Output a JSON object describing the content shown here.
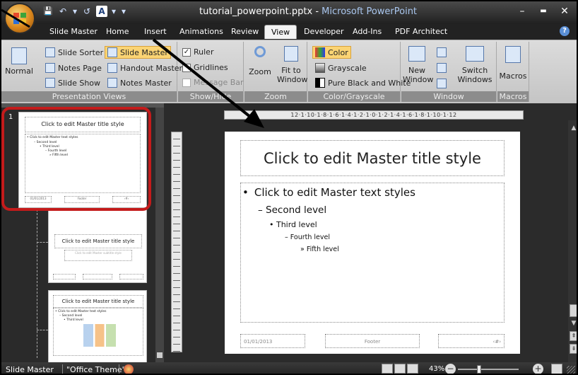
{
  "window": {
    "filename": "tutorial_powerpoint.pptx",
    "separator": " - ",
    "app_name": "Microsoft PowerPoint",
    "minimize": "–",
    "maximize": "▬",
    "close": "✕"
  },
  "qat": {
    "save": "💾",
    "undo": "↶",
    "redo": "↺",
    "font": "A",
    "dropdown": "▾",
    "customize": "▾"
  },
  "tabs": [
    "Slide Master",
    "Home",
    "Insert",
    "Animations",
    "Review",
    "View",
    "Developer",
    "Add-Ins",
    "PDF Architect"
  ],
  "active_tab": "View",
  "help": "?",
  "ribbon": {
    "presentation_views": {
      "label": "Presentation Views",
      "normal": "Normal",
      "slide_sorter": "Slide Sorter",
      "notes_page": "Notes Page",
      "slide_show": "Slide Show",
      "slide_master": "Slide Master",
      "handout_master": "Handout Master",
      "notes_master": "Notes Master"
    },
    "show_hide": {
      "label": "Show/Hide",
      "ruler": "Ruler",
      "gridlines": "Gridlines",
      "message_bar": "Message Bar",
      "ruler_checked": "✓"
    },
    "zoom": {
      "label": "Zoom",
      "zoom": "Zoom",
      "fit1": "Fit to",
      "fit2": "Window"
    },
    "color": {
      "label": "Color/Grayscale",
      "color": "Color",
      "grayscale": "Grayscale",
      "pure": "Pure Black and White"
    },
    "window": {
      "label": "Window",
      "new1": "New",
      "new2": "Window",
      "switch1": "Switch",
      "switch2": "Windows"
    },
    "macros": {
      "label": "Macros",
      "macros": "Macros"
    }
  },
  "thumb_slide_number": "1",
  "thumbs": {
    "master_title": "Click to edit Master title style",
    "body_l1": "• Click to edit Master text styles",
    "body_l2": "– Second level",
    "body_l3": "• Third level",
    "body_l4": "– Fourth level",
    "body_l5": "» Fifth level",
    "subtitle": "Click to edit Master subtitle style",
    "date": "01/01/2013",
    "footer": "Footer",
    "page": "‹#›"
  },
  "ruler_text": "12·1·10·1·8·1·6·1·4·1·2·1·0·1·2·1·4·1·6·1·8·1·10·1·12",
  "slide": {
    "title": "Click to edit Master title style",
    "level1": "Click to edit Master text styles",
    "level1_bullet": "•",
    "level2": "– Second level",
    "level3": "• Third level",
    "level4": "– Fourth level",
    "level5": "» Fifth level",
    "date": "01/01/2013",
    "footer": "Footer",
    "page": "‹#›"
  },
  "status": {
    "view": "Slide Master",
    "theme": "\"Office Theme\"",
    "zoom": "43%"
  },
  "colors": {
    "highlight_ring": "#c41b1b",
    "accent": "#fbd474",
    "title_app": "#a9c6ee"
  }
}
